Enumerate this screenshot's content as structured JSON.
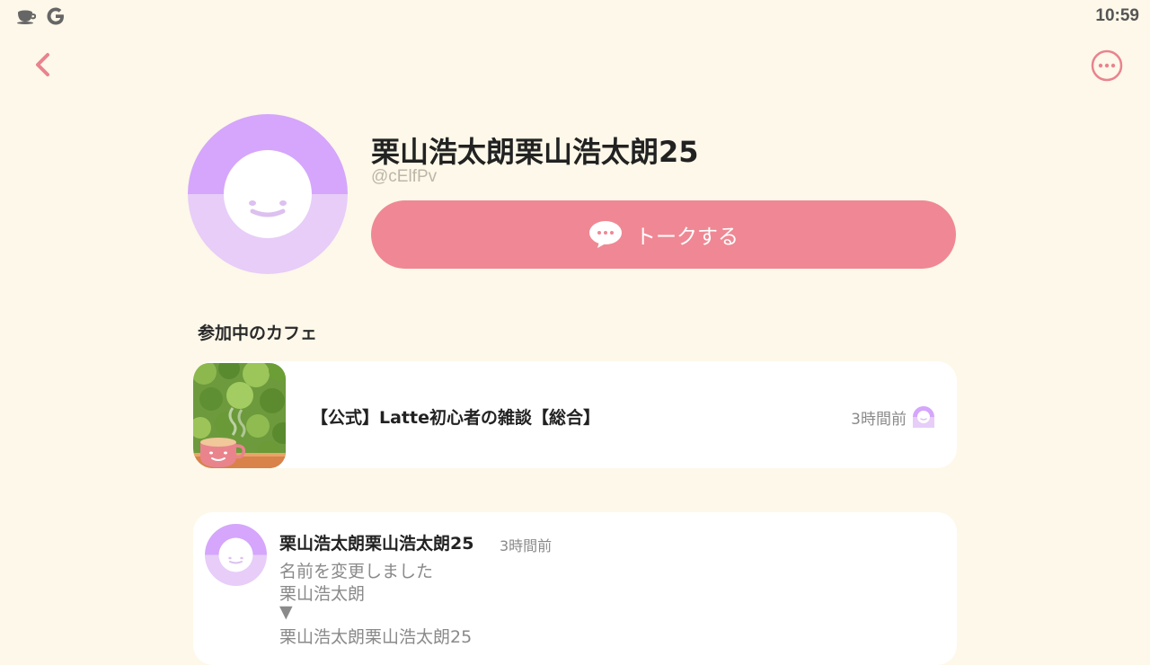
{
  "status_bar": {
    "time": "10:59",
    "icons": [
      "coffee-cup-icon",
      "google-icon"
    ]
  },
  "header": {
    "back_icon": "chevron-left-icon",
    "more_icon": "more-horizontal-circle-icon"
  },
  "profile": {
    "name": "栗山浩太朗栗山浩太朗25",
    "handle": "@cElfPv",
    "avatar_icon": "smiley-face-avatar-icon",
    "talk_button_label": "トークする",
    "talk_icon": "chat-bubble-icon"
  },
  "cafes": {
    "section_title": "参加中のカフェ",
    "items": [
      {
        "name": "【公式】Latte初心者の雑談【総合】",
        "time": "3時間前",
        "thumbnail_icon": "latte-cup-thumbnail",
        "badge_icon": "smiley-mini-icon"
      }
    ]
  },
  "activity": {
    "user": "栗山浩太朗栗山浩太朗25",
    "time": "3時間前",
    "message": "名前を変更しました",
    "old_name": "栗山浩太朗",
    "arrow": "▼",
    "new_name": "栗山浩太朗栗山浩太朗25"
  },
  "colors": {
    "background": "#fdf8e9",
    "accent_pink": "#ef8894",
    "avatar_purple_top": "#d5a6fb",
    "avatar_purple_bottom": "#e7cdf8",
    "icon_pink": "#e9838f"
  }
}
